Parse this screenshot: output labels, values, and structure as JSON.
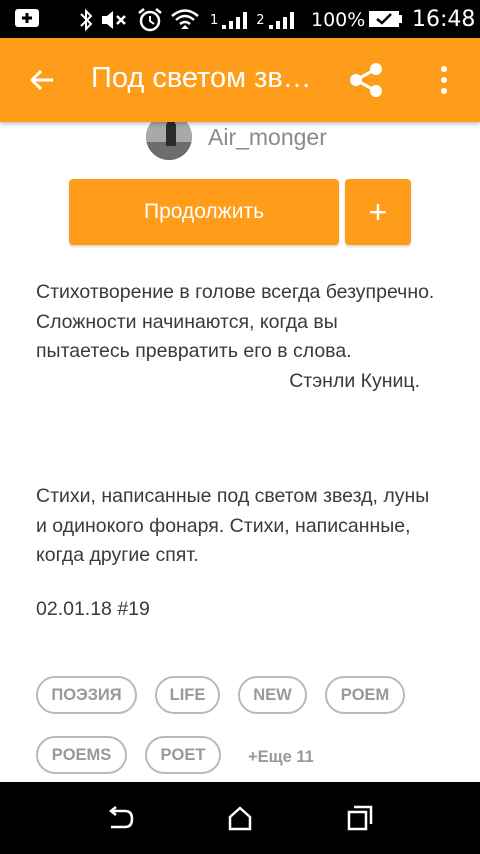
{
  "status_bar": {
    "battery_percent": "100%",
    "time": "16:48",
    "icons": [
      "add-box-icon",
      "bluetooth-icon",
      "mute-icon",
      "alarm-icon",
      "wifi-icon",
      "signal-icon",
      "signal-icon",
      "battery-icon"
    ],
    "signal_1_label": "1",
    "signal_2_label": "2"
  },
  "app_bar": {
    "title": "Под светом звезд, луны и одинокого фонаря",
    "back_icon": "arrow-back-icon",
    "share_icon": "share-icon",
    "more_icon": "more-vert-icon"
  },
  "author": {
    "name": "Air_monger"
  },
  "actions": {
    "continue_label": "Продолжить",
    "add_label": "+"
  },
  "description": {
    "quote": "Стихотворение в голове всегда безупречно. Сложности начинаются, когда вы пытаетесь превратить его в слова.",
    "quote_author": "Стэнли Куниц.",
    "paragraph": "Стихи, написанные под светом звезд, луны и одинокого фонаря. Стихи, написанные, когда другие спят.",
    "date_part": "02.01.18 #19"
  },
  "tags": [
    {
      "label": "ПОЭЗИЯ"
    },
    {
      "label": "LIFE"
    },
    {
      "label": "NEW"
    },
    {
      "label": "POEM"
    },
    {
      "label": "POEMS"
    },
    {
      "label": "POET"
    }
  ],
  "more_tags_label": "+Еще 11",
  "nav_bar": {
    "icons": [
      "back-nav-icon",
      "home-nav-icon",
      "recents-nav-icon"
    ]
  },
  "colors": {
    "accent": "#ff9c1a",
    "text": "#3a3a3a",
    "tag": "#999999"
  }
}
